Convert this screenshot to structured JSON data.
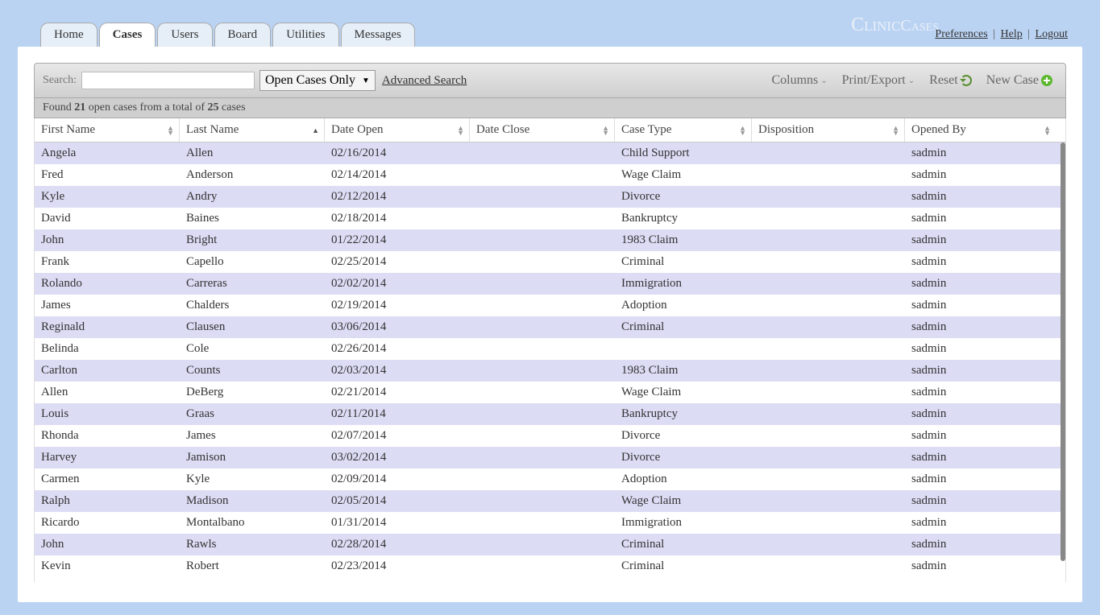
{
  "brand": {
    "part1": "Clinic",
    "part2": "Cases"
  },
  "header_links": {
    "prefs": "Preferences",
    "help": "Help",
    "logout": "Logout"
  },
  "tabs": [
    {
      "label": "Home",
      "active": false
    },
    {
      "label": "Cases",
      "active": true
    },
    {
      "label": "Users",
      "active": false
    },
    {
      "label": "Board",
      "active": false
    },
    {
      "label": "Utilities",
      "active": false
    },
    {
      "label": "Messages",
      "active": false
    }
  ],
  "toolbar": {
    "search_label": "Search:",
    "search_value": "",
    "filter_selected": "Open Cases Only",
    "advanced": "Advanced Search",
    "columns": "Columns",
    "print_export": "Print/Export",
    "reset": "Reset",
    "new_case": "New Case"
  },
  "status": {
    "prefix": "Found ",
    "count": "21",
    "mid": " open cases from a total of ",
    "total": "25",
    "suffix": " cases"
  },
  "columns": [
    {
      "label": "First Name",
      "sort": "both"
    },
    {
      "label": "Last Name",
      "sort": "asc"
    },
    {
      "label": "Date Open",
      "sort": "both"
    },
    {
      "label": "Date Close",
      "sort": "both"
    },
    {
      "label": "Case Type",
      "sort": "both"
    },
    {
      "label": "Disposition",
      "sort": "both"
    },
    {
      "label": "Opened By",
      "sort": "both"
    }
  ],
  "rows": [
    {
      "first": "Angela",
      "last": "Allen",
      "open": "02/16/2014",
      "close": "",
      "type": "Child Support",
      "disp": "",
      "by": "sadmin"
    },
    {
      "first": "Fred",
      "last": "Anderson",
      "open": "02/14/2014",
      "close": "",
      "type": "Wage Claim",
      "disp": "",
      "by": "sadmin"
    },
    {
      "first": "Kyle",
      "last": "Andry",
      "open": "02/12/2014",
      "close": "",
      "type": "Divorce",
      "disp": "",
      "by": "sadmin"
    },
    {
      "first": "David",
      "last": "Baines",
      "open": "02/18/2014",
      "close": "",
      "type": "Bankruptcy",
      "disp": "",
      "by": "sadmin"
    },
    {
      "first": "John",
      "last": "Bright",
      "open": "01/22/2014",
      "close": "",
      "type": "1983 Claim",
      "disp": "",
      "by": "sadmin"
    },
    {
      "first": "Frank",
      "last": "Capello",
      "open": "02/25/2014",
      "close": "",
      "type": "Criminal",
      "disp": "",
      "by": "sadmin"
    },
    {
      "first": "Rolando",
      "last": "Carreras",
      "open": "02/02/2014",
      "close": "",
      "type": "Immigration",
      "disp": "",
      "by": "sadmin"
    },
    {
      "first": "James",
      "last": "Chalders",
      "open": "02/19/2014",
      "close": "",
      "type": "Adoption",
      "disp": "",
      "by": "sadmin"
    },
    {
      "first": "Reginald",
      "last": "Clausen",
      "open": "03/06/2014",
      "close": "",
      "type": "Criminal",
      "disp": "",
      "by": "sadmin"
    },
    {
      "first": "Belinda",
      "last": "Cole",
      "open": "02/26/2014",
      "close": "",
      "type": "",
      "disp": "",
      "by": "sadmin"
    },
    {
      "first": "Carlton",
      "last": "Counts",
      "open": "02/03/2014",
      "close": "",
      "type": "1983 Claim",
      "disp": "",
      "by": "sadmin"
    },
    {
      "first": "Allen",
      "last": "DeBerg",
      "open": "02/21/2014",
      "close": "",
      "type": "Wage Claim",
      "disp": "",
      "by": "sadmin"
    },
    {
      "first": "Louis",
      "last": "Graas",
      "open": "02/11/2014",
      "close": "",
      "type": "Bankruptcy",
      "disp": "",
      "by": "sadmin"
    },
    {
      "first": "Rhonda",
      "last": "James",
      "open": "02/07/2014",
      "close": "",
      "type": "Divorce",
      "disp": "",
      "by": "sadmin"
    },
    {
      "first": "Harvey",
      "last": "Jamison",
      "open": "03/02/2014",
      "close": "",
      "type": "Divorce",
      "disp": "",
      "by": "sadmin"
    },
    {
      "first": "Carmen",
      "last": "Kyle",
      "open": "02/09/2014",
      "close": "",
      "type": "Adoption",
      "disp": "",
      "by": "sadmin"
    },
    {
      "first": "Ralph",
      "last": "Madison",
      "open": "02/05/2014",
      "close": "",
      "type": "Wage Claim",
      "disp": "",
      "by": "sadmin"
    },
    {
      "first": "Ricardo",
      "last": "Montalbano",
      "open": "01/31/2014",
      "close": "",
      "type": "Immigration",
      "disp": "",
      "by": "sadmin"
    },
    {
      "first": "John",
      "last": "Rawls",
      "open": "02/28/2014",
      "close": "",
      "type": "Criminal",
      "disp": "",
      "by": "sadmin"
    },
    {
      "first": "Kevin",
      "last": "Robert",
      "open": "02/23/2014",
      "close": "",
      "type": "Criminal",
      "disp": "",
      "by": "sadmin"
    }
  ]
}
